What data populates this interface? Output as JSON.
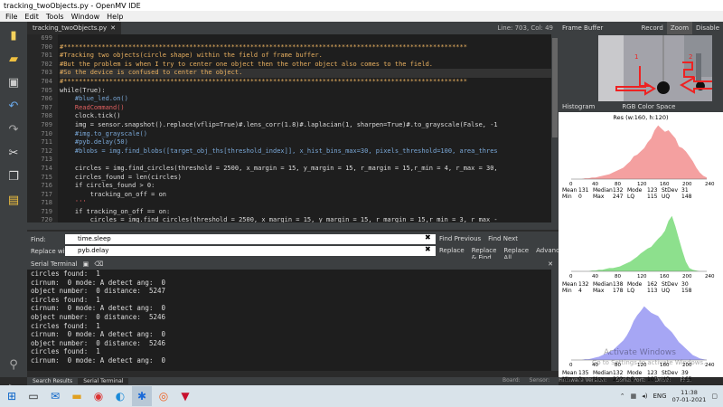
{
  "window": {
    "title": "tracking_twoObjects.py - OpenMV IDE"
  },
  "menu": [
    "File",
    "Edit",
    "Tools",
    "Window",
    "Help"
  ],
  "editor": {
    "tab_label": "tracking_twoObjects.py",
    "line_col": "Line: 703, Col: 49",
    "line_numbers": [
      "699",
      "700",
      "701",
      "702",
      "703",
      "704",
      "705",
      "706",
      "707",
      "708",
      "709",
      "710",
      "711",
      "712",
      "713",
      "714",
      "715",
      "716",
      "717",
      "718",
      "719",
      "720",
      "721"
    ],
    "lines": [
      "",
      "#**********************************************************************************************************",
      "#Tracking two objects(circle shape) within the field of frame buffer.",
      "#But the problem is when I try to center one object then the other object also comes to the field.",
      "#So the device is confused to center the object.",
      "#**********************************************************************************************************",
      "while(True):",
      "    #blue_led.on()",
      "    ReadCommand()",
      "    clock.tick()",
      "    img = sensor.snapshot().replace(vflip=True)#.lens_corr(1.8)#.laplacian(1, sharpen=True)#.to_grayscale(False, -1",
      "    #img.to_grayscale()",
      "    #pyb.delay(50)",
      "    #blobs = img.find_blobs([target_obj_ths[threshold_index]], x_hist_bins_max=30, pixels_threshold=100, area_thres",
      "",
      "    circles = img.find_circles(threshold = 2500, x_margin = 15, y_margin = 15, r_margin = 15,r_min = 4, r_max = 30,",
      "    circles_found = len(circles)",
      "    if circles_found > 0:",
      "        tracking_on_off = on",
      "    '''",
      "    if tracking_on_off == on:",
      "        circles = img.find_circles(threshold = 2500, x_margin = 15, y_margin = 15, r_margin = 15,r_min = 3, r_max -",
      ""
    ]
  },
  "find": {
    "find_label": "Find:",
    "find_value": "time.sleep",
    "replace_label": "Replace with:",
    "replace_value": "pyb.delay",
    "find_previous": "Find Previous",
    "find_next": "Find Next",
    "replace": "Replace",
    "replace_find": "Replace & Find",
    "replace_all": "Replace All",
    "advanced": "Advanced..."
  },
  "serial": {
    "title": "Serial Terminal",
    "lines": [
      "circles found:  1",
      "cirnum:  0 mode: A detect ang:  0",
      "object number:  0 distance:  5247",
      "circles found:  1",
      "cirnum:  0 mode: A detect ang:  0",
      "object number:  0 distance:  5246",
      "circles found:  1",
      "cirnum:  0 mode: A detect ang:  0",
      "object number:  0 distance:  5246",
      "circles found:  1",
      "cirnum:  0 mode: A detect ang:  0"
    ]
  },
  "bottom_tabs": [
    "Search Results",
    "Serial Terminal"
  ],
  "status": [
    "Board:",
    "Sensor:",
    "Firmware Version:",
    "Serial Port:",
    "Drive:",
    "FPS:"
  ],
  "frame_buffer": {
    "title": "Frame Buffer",
    "buttons": [
      "Record",
      "Zoom",
      "Disable"
    ],
    "annotation_1": "1",
    "annotation_2": "2"
  },
  "histogram": {
    "title": "Histogram",
    "color_space": "RGB Color Space",
    "res": "Res (w:160, h:120)",
    "ticks": [
      "0",
      "40",
      "80",
      "120",
      "160",
      "200",
      "240"
    ],
    "channels": [
      {
        "color": "#f4a0a0",
        "stats": [
          "Mean",
          "131",
          "Median",
          "132",
          "Mode",
          "123",
          "StDev",
          "31",
          "Min",
          "0",
          "Max",
          "247",
          "LQ",
          "115",
          "UQ",
          "148"
        ]
      },
      {
        "color": "#8de08d",
        "stats": [
          "Mean",
          "132",
          "Median",
          "138",
          "Mode",
          "162",
          "StDev",
          "30",
          "Min",
          "4",
          "Max",
          "178",
          "LQ",
          "113",
          "UQ",
          "158"
        ]
      },
      {
        "color": "#a6a6f4",
        "stats": [
          "Mean",
          "135",
          "Median",
          "132",
          "Mode",
          "123",
          "StDev",
          "39",
          "Min",
          "0",
          "Max",
          "222",
          "LQ",
          "107",
          "UQ",
          "165"
        ]
      }
    ]
  },
  "watermark": {
    "line1": "Activate Windows",
    "line2": "Go to Settings to activate Windows."
  },
  "taskbar": {
    "lang": "ENG",
    "time": "11:38",
    "date": "07-01-2021"
  }
}
